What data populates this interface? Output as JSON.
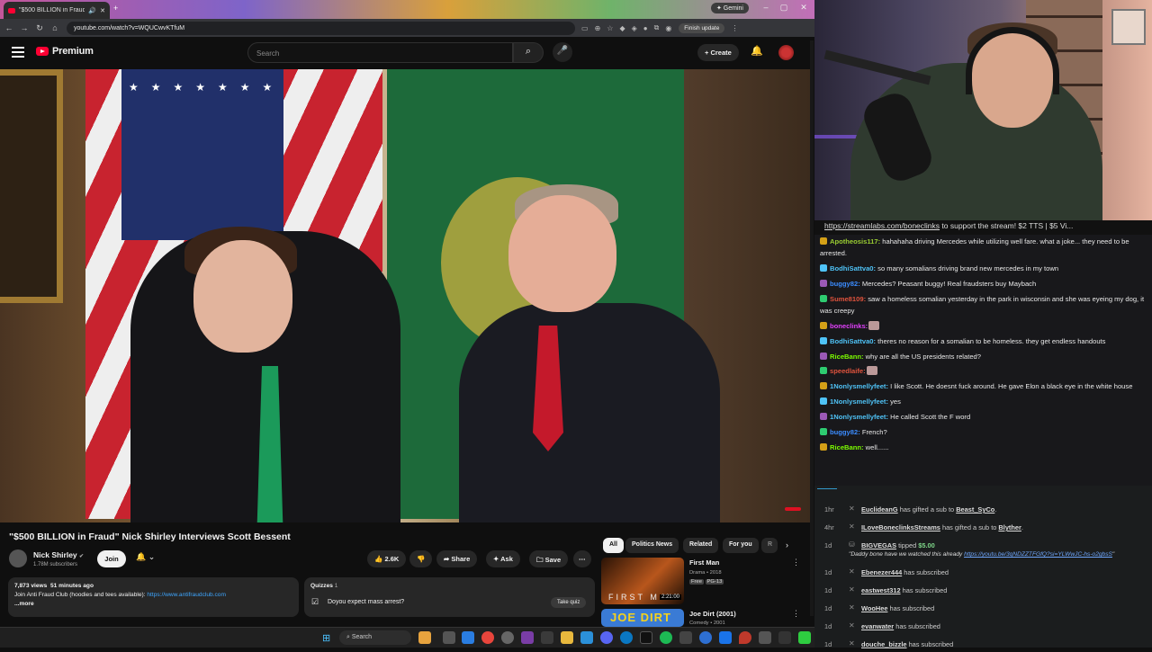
{
  "browser": {
    "tab_title": "\"$500 BILLION in Fraud\" N...",
    "gemini": "✦ Gemini",
    "url": "youtube.com/watch?v=WQUCwvKTfuM",
    "finish_update": "Finish update"
  },
  "youtube": {
    "logo_text": "Premium",
    "search_placeholder": "Search",
    "create_label": "Create",
    "video_title": "\"$500 BILLION in Fraud\" Nick Shirley Interviews Scott Bessent",
    "channel_name": "Nick Shirley",
    "verified": "✔",
    "subscribers": "1.78M subscribers",
    "join_label": "Join",
    "likes": "2.6K",
    "share_label": "Share",
    "ask_label": "Ask",
    "save_label": "Save",
    "views": "7,873 views",
    "age": "51 minutes ago",
    "desc_text": "Join Anti Fraud Club (hoodies and tees available): ",
    "desc_link": "https://www.antifraudclub.com",
    "more": "...more",
    "quizzes_label": "Quizzes",
    "quizzes_count": "1",
    "quiz_question": "Doyou expect mass arrest?",
    "take_quiz": "Take quiz",
    "chips": [
      "All",
      "Politics News",
      "Related",
      "For you"
    ],
    "chip_more": "R",
    "related": [
      {
        "title": "First Man",
        "meta": "Drama • 2018",
        "badge1": "Free",
        "badge2": "PG-13",
        "thumb_text": "FIRST M",
        "duration": "2:21:00"
      },
      {
        "title": "Joe Dirt (2001)",
        "meta": "Comedy • 2001",
        "thumb_text": "JOE DIRT"
      }
    ]
  },
  "chat": {
    "ticker_link": "https://streamlabs.com/boneclinks",
    "ticker_text": " to support the stream! $2 TTS | $5 Vi...",
    "messages": [
      {
        "user": "Apotheosis117:",
        "color": "#9acd32",
        "text": " hahahaha driving Mercedes while utilizing well fare. what a joke... they need to be arrested."
      },
      {
        "user": "BodhiSattva0:",
        "color": "#4fc3f7",
        "text": " so many somalians driving brand new mercedes in my town"
      },
      {
        "user": "buggy82:",
        "color": "#3b8cff",
        "text": " Mercedes? Peasant buggy! Real fraudsters buy Maybach"
      },
      {
        "user": "Sume8109:",
        "color": "#e0533d",
        "text": " saw a homeless somalian yesterday in the park in wisconsin and she was eyeing my dog, it was creepy"
      },
      {
        "user": "boneclinks:",
        "color": "#e040fb",
        "text": ""
      },
      {
        "user": "BodhiSattva0:",
        "color": "#4fc3f7",
        "text": " theres no reason for a somalian to be homeless. they get endless handouts"
      },
      {
        "user": "RiceBann:",
        "color": "#7cfc00",
        "text": " why are all the US presidents related?"
      },
      {
        "user": "speedlaife:",
        "color": "#e0533d",
        "text": ""
      },
      {
        "user": "1Nonlysmellyfeet:",
        "color": "#4fc3f7",
        "text": " I like Scott. He doesnt fuck around. He gave Elon a black eye in the white house"
      },
      {
        "user": "1Nonlysmellyfeet:",
        "color": "#4fc3f7",
        "text": " yes"
      },
      {
        "user": "1Nonlysmellyfeet:",
        "color": "#4fc3f7",
        "text": " He called Scott the F word"
      },
      {
        "user": "buggy82:",
        "color": "#3b8cff",
        "text": " French?"
      },
      {
        "user": "RiceBann:",
        "color": "#7cfc00",
        "text": " well......"
      }
    ]
  },
  "events": [
    {
      "time": "1hr",
      "user": "EuclideanG",
      "text": " has gifted a sub to ",
      "target": "Beast_SyCo",
      "tail": "."
    },
    {
      "time": "4hr",
      "user": "ILoveBoneclinksStreams",
      "text": " has gifted a sub to ",
      "target": "Blyther",
      "tail": "."
    },
    {
      "time": "1d",
      "user": "BIGVEGAS",
      "text": " tipped ",
      "money": "$5.00",
      "quote": "\"Daddy bone have we watched this already ",
      "link": "https://youtu.be/3qNDZZTFGfQ?si=YLWwJC-hs-o2gbsS",
      "quote_end": "\""
    },
    {
      "time": "1d",
      "user": "Ebenezer444",
      "text": " has subscribed"
    },
    {
      "time": "1d",
      "user": "eastwest312",
      "text": " has subscribed"
    },
    {
      "time": "1d",
      "user": "WooHee",
      "text": " has subscribed"
    },
    {
      "time": "1d",
      "user": "evanwater",
      "text": " has subscribed"
    },
    {
      "time": "1d",
      "user": "douche_bizzle",
      "text": " has subscribed"
    }
  ],
  "taskbar": {
    "search": "Search"
  },
  "colors": {
    "yt_red": "#ff0033",
    "link_blue": "#3ea6ff",
    "chat_bg": "#18181b",
    "tip_green": "#7fd88a"
  }
}
